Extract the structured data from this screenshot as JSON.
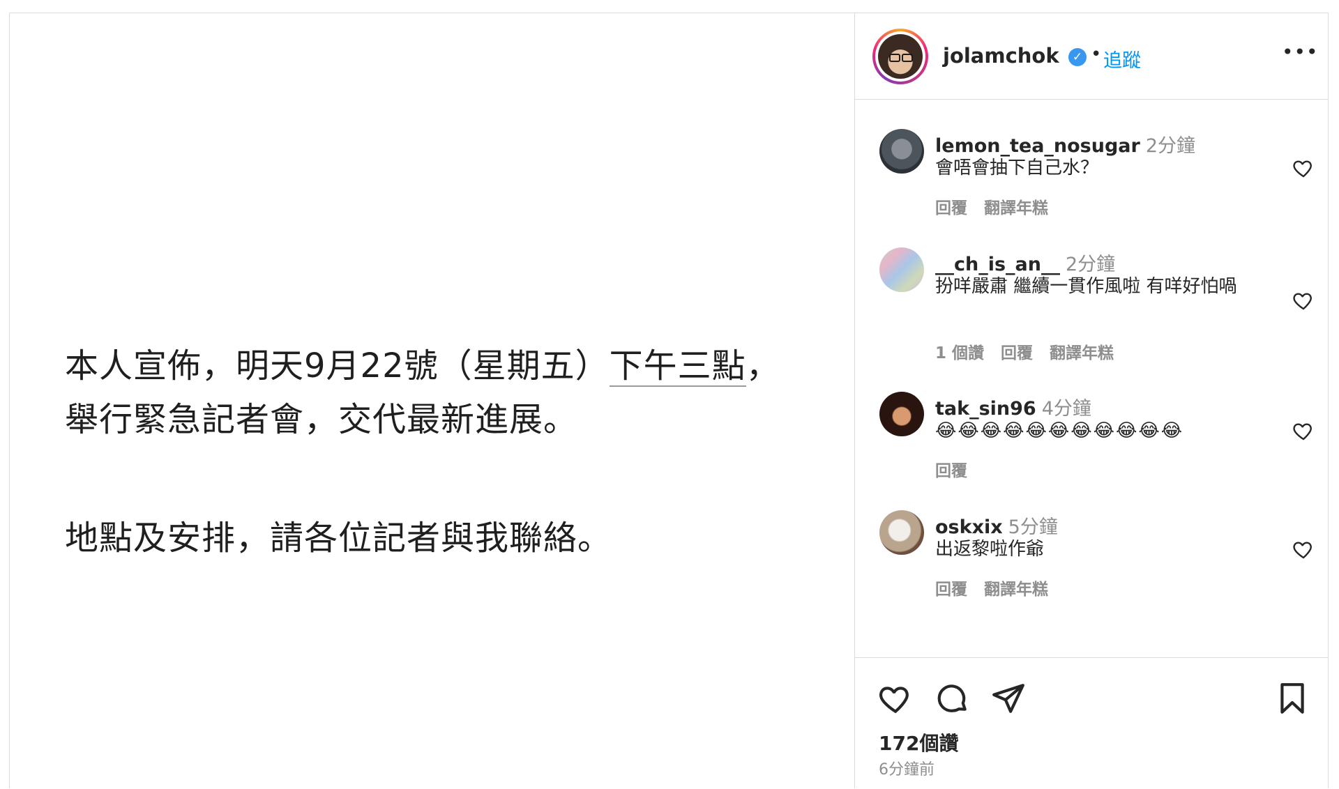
{
  "post": {
    "paragraph1_part1": "本人宣佈，明天9月22號（星期五）",
    "paragraph1_underlined": "下午三點",
    "paragraph1_part2": "，舉行緊急記者會，交代最新進展。",
    "paragraph2": "地點及安排，請各位記者與我聯絡。"
  },
  "header": {
    "username": "jolamchok",
    "verified_glyph": "✓",
    "separator": "•",
    "follow_label": "追蹤",
    "more_label": "•••"
  },
  "comments": [
    {
      "username": "lemon_tea_nosugar",
      "time": "2分鐘",
      "text": "會唔會抽下自己水？",
      "likes": "",
      "reply": "回覆",
      "translate": "翻譯年糕"
    },
    {
      "username": "__ch_is_an__",
      "time": "2分鐘",
      "text": "扮咩嚴肅 繼續一貫作風啦 有咩好怕喎",
      "likes": "1 個讚",
      "reply": "回覆",
      "translate": "翻譯年糕"
    },
    {
      "username": "tak_sin96",
      "time": "4分鐘",
      "text": "😂😂😂😂😂😂😂😂😂😂😂",
      "likes": "",
      "reply": "回覆",
      "translate": ""
    },
    {
      "username": "oskxix",
      "time": "5分鐘",
      "text": "出返黎啦作爺",
      "likes": "",
      "reply": "回覆",
      "translate": "翻譯年糕"
    }
  ],
  "footer": {
    "likes_count": "172個讚",
    "post_age": "6分鐘前"
  },
  "icons": {
    "like": "heart-icon",
    "comment": "comment-bubble-icon",
    "share": "paper-plane-icon",
    "save": "bookmark-icon",
    "verified": "verified-badge-icon"
  },
  "colors": {
    "accent_blue": "#0095f6",
    "verified_blue": "#3897f0",
    "muted_text": "#8e8e8e",
    "border": "#dbdbdb"
  }
}
